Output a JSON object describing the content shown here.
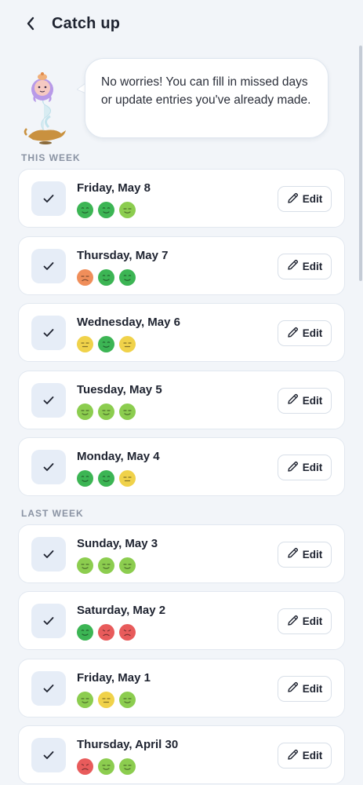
{
  "header": {
    "title": "Catch up",
    "back_icon": "chevron-left-icon"
  },
  "intro": {
    "message": "No worries! You can fill in missed days or update entries you've already made."
  },
  "colors": {
    "great": "#3cb554",
    "good": "#8ccd4f",
    "okay": "#f0d24a",
    "meh": "#f08e5a",
    "bad": "#e85b5b"
  },
  "sections": [
    {
      "label": "THIS WEEK",
      "days": [
        {
          "label": "Friday, May 8",
          "moods": [
            "great",
            "great",
            "good"
          ],
          "edit_label": "Edit"
        },
        {
          "label": "Thursday, May 7",
          "moods": [
            "meh",
            "great",
            "great"
          ],
          "edit_label": "Edit"
        },
        {
          "label": "Wednesday, May 6",
          "moods": [
            "okay",
            "great",
            "okay"
          ],
          "edit_label": "Edit"
        },
        {
          "label": "Tuesday, May 5",
          "moods": [
            "good",
            "good",
            "good"
          ],
          "edit_label": "Edit"
        },
        {
          "label": "Monday, May 4",
          "moods": [
            "great",
            "great",
            "okay"
          ],
          "edit_label": "Edit"
        }
      ]
    },
    {
      "label": "LAST WEEK",
      "days": [
        {
          "label": "Sunday, May 3",
          "moods": [
            "good",
            "good",
            "good"
          ],
          "edit_label": "Edit"
        },
        {
          "label": "Saturday, May 2",
          "moods": [
            "great",
            "bad",
            "bad"
          ],
          "edit_label": "Edit"
        },
        {
          "label": "Friday, May 1",
          "moods": [
            "good",
            "okay",
            "good"
          ],
          "edit_label": "Edit"
        },
        {
          "label": "Thursday, April 30",
          "moods": [
            "bad",
            "good",
            "good"
          ],
          "edit_label": "Edit"
        }
      ]
    }
  ]
}
